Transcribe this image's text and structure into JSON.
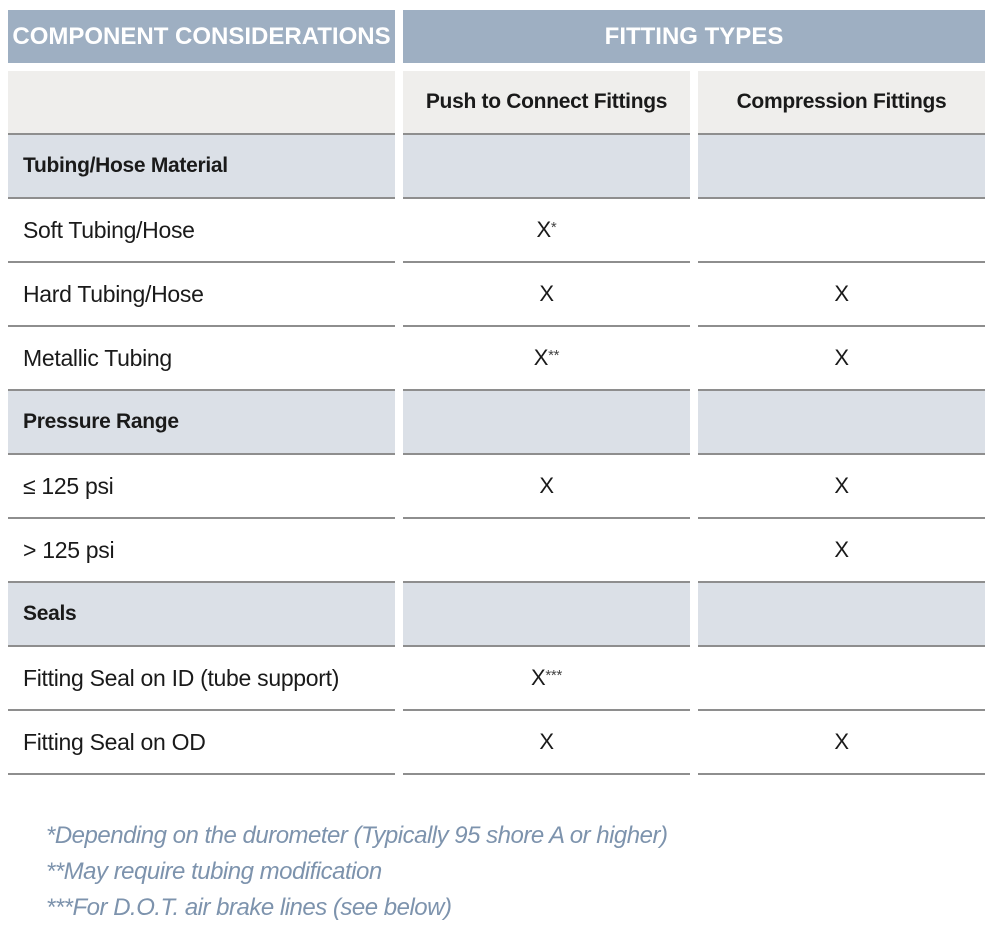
{
  "header": {
    "component_title": "COMPONENT CONSIDERATIONS",
    "fitting_types_title": "FITTING TYPES",
    "columns": [
      "Push to Connect Fittings",
      "Compression Fittings"
    ]
  },
  "rows": [
    {
      "type": "section",
      "label": "Tubing/Hose Material",
      "push": "",
      "compression": ""
    },
    {
      "type": "item",
      "label": "Soft Tubing/Hose",
      "push": "X*",
      "compression": ""
    },
    {
      "type": "item",
      "label": "Hard Tubing/Hose",
      "push": "X",
      "compression": "X"
    },
    {
      "type": "item",
      "label": "Metallic Tubing",
      "push": "X**",
      "compression": "X"
    },
    {
      "type": "section",
      "label": "Pressure Range",
      "push": "",
      "compression": ""
    },
    {
      "type": "item",
      "label": "≤ 125 psi",
      "push": "X",
      "compression": "X"
    },
    {
      "type": "item",
      "label": "> 125 psi",
      "push": "",
      "compression": "X"
    },
    {
      "type": "section",
      "label": "Seals",
      "push": "",
      "compression": ""
    },
    {
      "type": "item",
      "label": "Fitting Seal on ID (tube support)",
      "push": "X***",
      "compression": ""
    },
    {
      "type": "item",
      "label": "Fitting Seal on OD",
      "push": "X",
      "compression": "X"
    }
  ],
  "footnotes": [
    "*Depending on the durometer (Typically 95 shore A or higher)",
    "**May require tubing modification",
    "***For D.O.T. air brake lines (see below)"
  ],
  "colors": {
    "header_bg": "#9eafc2",
    "subheader_bg": "#efeeec",
    "section_bg": "#dbe0e7",
    "rule": "#8e8e8e",
    "footnote_text": "#7d93ad"
  }
}
